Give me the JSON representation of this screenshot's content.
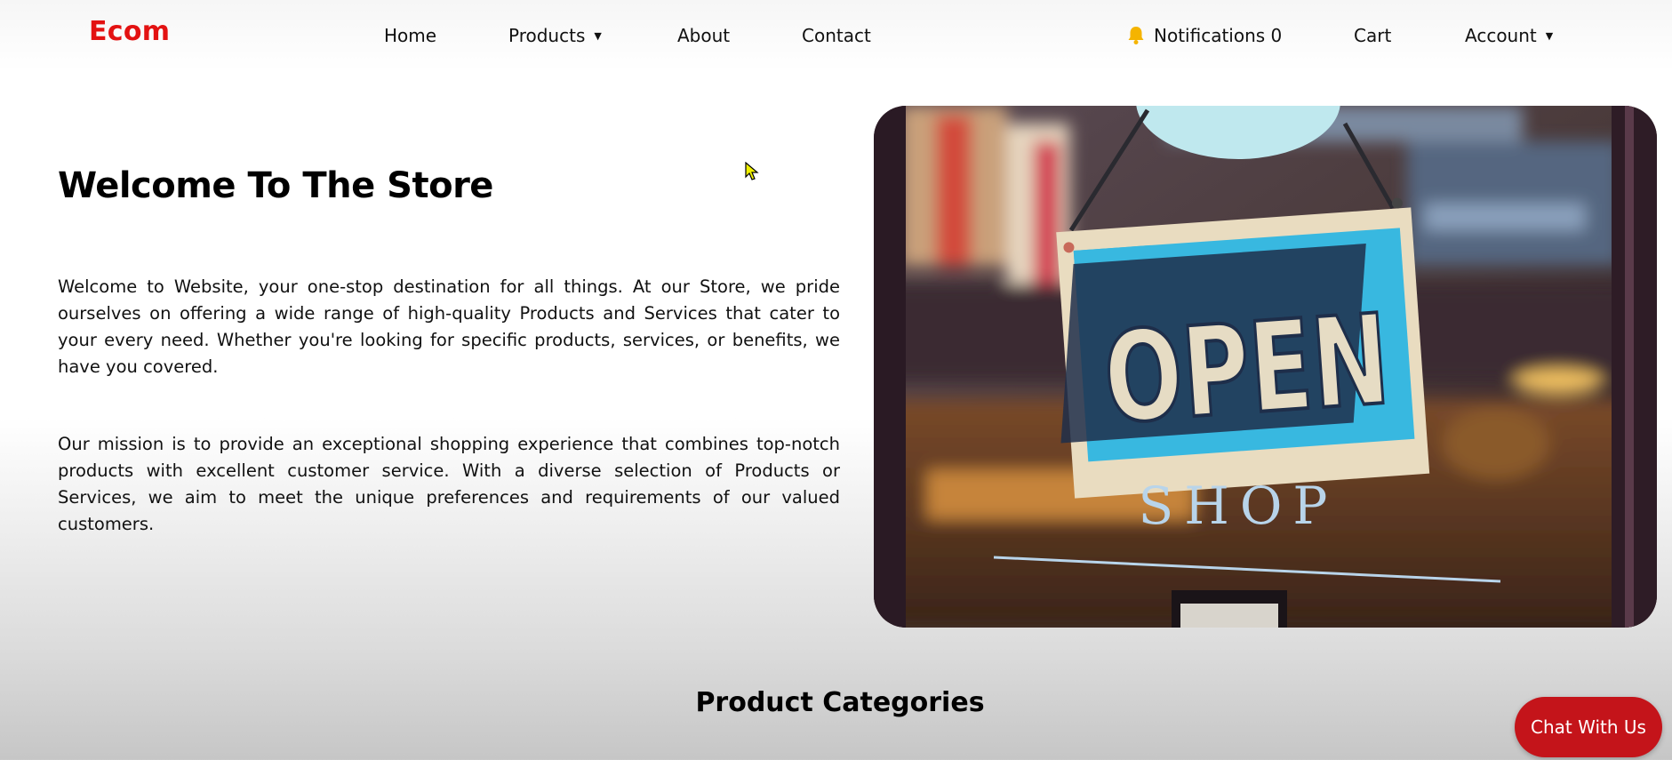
{
  "brand": "Ecom",
  "nav": {
    "home": "Home",
    "products": "Products",
    "about": "About",
    "contact": "Contact",
    "notifications": "Notifications 0",
    "cart": "Cart",
    "account": "Account",
    "dropdown_glyph": "▼"
  },
  "hero": {
    "title": "Welcome To The Store",
    "paragraph1": "Welcome to Website, your one-stop destination for all things. At our Store, we pride ourselves on offering a wide range of high-quality Products and Services that cater to your every need. Whether you're looking for specific products, services, or benefits, we have you covered.",
    "paragraph2": "Our mission is to provide an exceptional shopping experience that combines top-notch products with excellent customer service. With a diverse selection of Products or Services, we aim to meet the unique preferences and requirements of our valued customers.",
    "image_icon": "open-shop-sign-photo",
    "sign_word": "OPEN",
    "shop_word": "SHOP"
  },
  "section_title": "Product Categories",
  "chat_button": "Chat With Us",
  "colors": {
    "brand": "#e31212",
    "chat_button": "#c4141a",
    "bell": "#f5b400"
  }
}
